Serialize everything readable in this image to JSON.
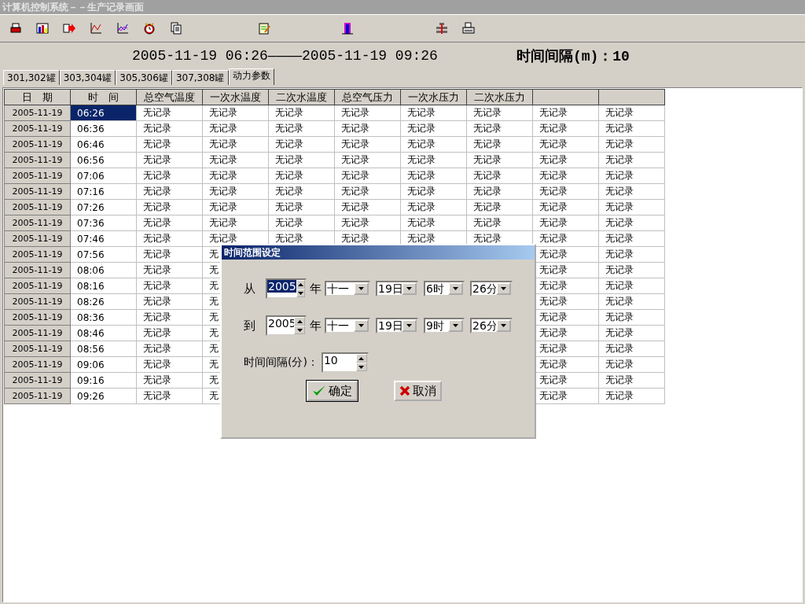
{
  "window": {
    "title": "计算机控制系统－－生产记录画面"
  },
  "header": {
    "range": "2005-11-19 06:26————2005-11-19 09:26",
    "interval": "时间间隔(m)：10"
  },
  "tabs": [
    {
      "label": "301,302罐",
      "selected": false
    },
    {
      "label": "303,304罐",
      "selected": false
    },
    {
      "label": "305,306罐",
      "selected": false
    },
    {
      "label": "307,308罐",
      "selected": false
    },
    {
      "label": "动力参数",
      "selected": true
    }
  ],
  "table": {
    "columns": [
      "日　期",
      "时　间",
      "总空气温度",
      "一次水温度",
      "二次水温度",
      "总空气压力",
      "一次水压力",
      "二次水压力",
      null,
      null
    ],
    "rows": [
      {
        "selected": true,
        "cells": [
          "2005-11-19",
          "06:26",
          "无记录",
          "无记录",
          "无记录",
          "无记录",
          "无记录",
          "无记录",
          "无记录",
          "无记录"
        ]
      },
      {
        "selected": false,
        "cells": [
          "2005-11-19",
          "06:36",
          "无记录",
          "无记录",
          "无记录",
          "无记录",
          "无记录",
          "无记录",
          "无记录",
          "无记录"
        ]
      },
      {
        "selected": false,
        "cells": [
          "2005-11-19",
          "06:46",
          "无记录",
          "无记录",
          "无记录",
          "无记录",
          "无记录",
          "无记录",
          "无记录",
          "无记录"
        ]
      },
      {
        "selected": false,
        "cells": [
          "2005-11-19",
          "06:56",
          "无记录",
          "无记录",
          "无记录",
          "无记录",
          "无记录",
          "无记录",
          "无记录",
          "无记录"
        ]
      },
      {
        "selected": false,
        "cells": [
          "2005-11-19",
          "07:06",
          "无记录",
          "无记录",
          "无记录",
          "无记录",
          "无记录",
          "无记录",
          "无记录",
          "无记录"
        ]
      },
      {
        "selected": false,
        "cells": [
          "2005-11-19",
          "07:16",
          "无记录",
          "无记录",
          "无记录",
          "无记录",
          "无记录",
          "无记录",
          "无记录",
          "无记录"
        ]
      },
      {
        "selected": false,
        "cells": [
          "2005-11-19",
          "07:26",
          "无记录",
          "无记录",
          "无记录",
          "无记录",
          "无记录",
          "无记录",
          "无记录",
          "无记录"
        ]
      },
      {
        "selected": false,
        "cells": [
          "2005-11-19",
          "07:36",
          "无记录",
          "无记录",
          "无记录",
          "无记录",
          "无记录",
          "无记录",
          "无记录",
          "无记录"
        ]
      },
      {
        "selected": false,
        "cells": [
          "2005-11-19",
          "07:46",
          "无记录",
          "无记录",
          "无记录",
          "无记录",
          "无记录",
          "无记录",
          "无记录",
          "无记录"
        ]
      },
      {
        "selected": false,
        "cells": [
          "2005-11-19",
          "07:56",
          "无记录",
          "无",
          null,
          null,
          null,
          null,
          "无记录",
          "无记录"
        ]
      },
      {
        "selected": false,
        "cells": [
          "2005-11-19",
          "08:06",
          "无记录",
          "无",
          null,
          null,
          null,
          null,
          "无记录",
          "无记录"
        ]
      },
      {
        "selected": false,
        "cells": [
          "2005-11-19",
          "08:16",
          "无记录",
          "无",
          null,
          null,
          null,
          null,
          "无记录",
          "无记录"
        ]
      },
      {
        "selected": false,
        "cells": [
          "2005-11-19",
          "08:26",
          "无记录",
          "无",
          null,
          null,
          null,
          null,
          "无记录",
          "无记录"
        ]
      },
      {
        "selected": false,
        "cells": [
          "2005-11-19",
          "08:36",
          "无记录",
          "无",
          null,
          null,
          null,
          null,
          "无记录",
          "无记录"
        ]
      },
      {
        "selected": false,
        "cells": [
          "2005-11-19",
          "08:46",
          "无记录",
          "无",
          null,
          null,
          null,
          null,
          "无记录",
          "无记录"
        ]
      },
      {
        "selected": false,
        "cells": [
          "2005-11-19",
          "08:56",
          "无记录",
          "无",
          null,
          null,
          null,
          null,
          "无记录",
          "无记录"
        ]
      },
      {
        "selected": false,
        "cells": [
          "2005-11-19",
          "09:06",
          "无记录",
          "无",
          null,
          null,
          null,
          null,
          "无记录",
          "无记录"
        ]
      },
      {
        "selected": false,
        "cells": [
          "2005-11-19",
          "09:16",
          "无记录",
          "无",
          null,
          null,
          null,
          null,
          "无记录",
          "无记录"
        ]
      },
      {
        "selected": false,
        "cells": [
          "2005-11-19",
          "09:26",
          "无记录",
          "无",
          null,
          null,
          null,
          null,
          "无记录",
          "无记录"
        ]
      }
    ]
  },
  "dialog": {
    "title": "时间范围设定",
    "ranges": [
      {
        "label": "从",
        "year": "2005",
        "year_selected": true,
        "unit": "年",
        "month": "十一",
        "day": "19日",
        "hour": "6时",
        "minute": "26分"
      },
      {
        "label": "到",
        "year": "2005",
        "year_selected": false,
        "unit": "年",
        "month": "十一",
        "day": "19日",
        "hour": "9时",
        "minute": "26分"
      }
    ],
    "interval_label": "时间间隔(分)：",
    "interval": "10",
    "buttons": [
      {
        "kind": "ok",
        "label": "确定",
        "default": true
      },
      {
        "kind": "cancel",
        "label": "取消",
        "default": false
      }
    ]
  }
}
